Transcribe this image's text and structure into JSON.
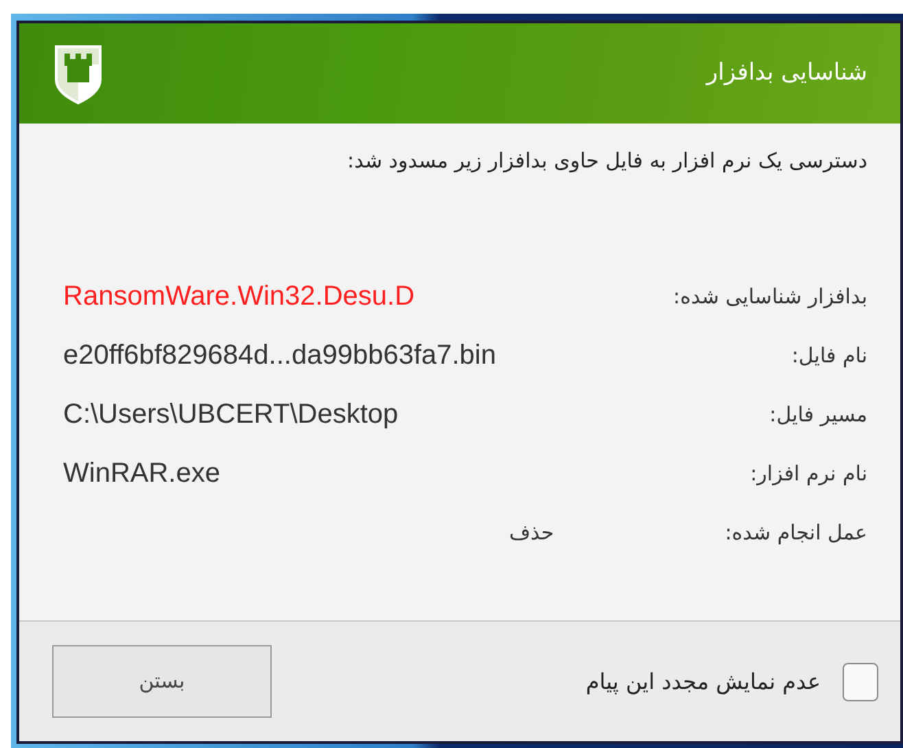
{
  "window": {
    "title": "شناسایی بدافزار"
  },
  "message": "دسترسی یک نرم افزار به فایل حاوی بدافزار زیر مسدود شد:",
  "fields": [
    {
      "kind": "threat",
      "label": "بدافزار شناسایی شده:",
      "value": "RansomWare.Win32.Desu.D"
    },
    {
      "kind": "info",
      "label": "نام فایل:",
      "value": "e20ff6bf829684d...da99bb63fa7.bin"
    },
    {
      "kind": "info",
      "label": "مسیر فایل:",
      "value": "C:\\Users\\UBCERT\\Desktop"
    },
    {
      "kind": "info",
      "label": "نام نرم افزار:",
      "value": "WinRAR.exe"
    },
    {
      "kind": "action",
      "label": "عمل انجام شده:",
      "value": "حذف"
    }
  ],
  "checkbox": {
    "label": "عدم نمایش مجدد این پیام",
    "checked": false
  },
  "button": {
    "label": "بستن"
  }
}
